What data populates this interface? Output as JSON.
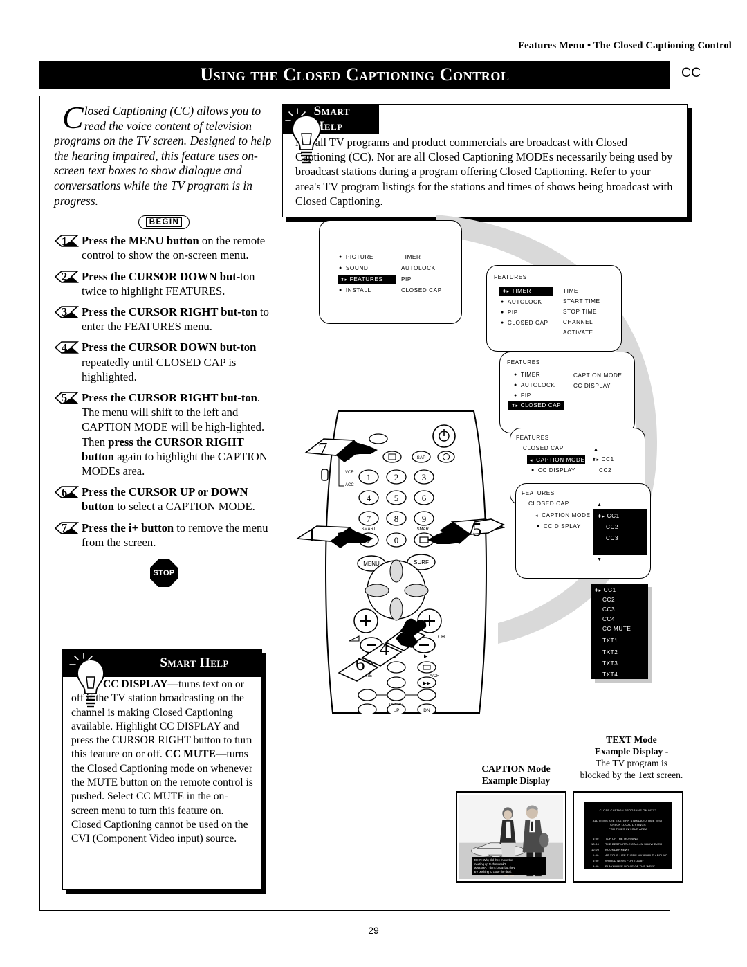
{
  "header": {
    "running_head": "Features Menu • The Closed Captioning Control",
    "title": "Using the Closed Captioning Control",
    "cc_badge": "CC"
  },
  "page_number": "29",
  "intro": {
    "dropcap": "C",
    "text": "losed Captioning (CC) allows you to read the voice content of television programs on the TV screen. Designed to help the hearing impaired, this feature uses on-screen text boxes to show dialogue and conversations while the TV program is in progress."
  },
  "begin_badge": "BEGIN",
  "steps": [
    {
      "num": "1",
      "bold": "Press the MENU button",
      "rest": " on the remote control to show the on-screen menu."
    },
    {
      "num": "2",
      "bold": "Press the CURSOR DOWN but-",
      "rest": ""
    },
    {
      "num": "3",
      "bold": "Press the CURSOR RIGHT but-",
      "rest": ""
    },
    {
      "num": "4",
      "bold": "Press the CURSOR DOWN but-",
      "rest": ""
    },
    {
      "num": "5",
      "bold": "Press the CURSOR RIGHT but-",
      "rest": ""
    },
    {
      "num": "6",
      "bold": "Press the CURSOR UP or",
      "rest": ""
    },
    {
      "num": "7",
      "bold": "Press the i+ button",
      "rest": " to remove the menu from the screen."
    }
  ],
  "step_lines": {
    "s2_b": "Press the CURSOR DOWN but-",
    "s2_t": "ton twice to highlight FEATURES.",
    "s3_b": "Press the CURSOR RIGHT but-",
    "s3_b2": "ton",
    "s3_t": " to enter the FEATURES menu.",
    "s4_b": "Press the CURSOR DOWN but-",
    "s4_b2": "ton",
    "s4_t": " repeatedly until CLOSED CAP is highlighted.",
    "s5_b": "Press the CURSOR RIGHT but-",
    "s5_b2": "ton",
    "s5_t": ". The menu will shift to the left and CAPTION MODE will be high-lighted. Then ",
    "s5_b3": "press the CURSOR RIGHT button",
    "s5_t2": " again to highlight the CAPTION MODEs area.",
    "s6_b": "Press the CURSOR UP or DOWN button",
    "s6_t": " to select a CAPTION MODE."
  },
  "stop_label": "STOP",
  "smart_help_top": {
    "label": "Smart Help",
    "text": "Not all TV programs and product commercials are broadcast with Closed Captioning (CC). Nor are all Closed Captioning MODEs necessarily being used by broadcast stations during a program offering Closed Captioning. Refer to your area's TV program listings for the stations and times of shows being broadcast with Closed Captioning."
  },
  "smart_help_bottom": {
    "label": "Smart Help",
    "p1_bold": "CC DISPLAY",
    "p1": "—turns text on or off if the TV station broadcasting on the channel is making Closed Captioning available. Highlight CC DISPLAY and press the CURSOR RIGHT button to turn this feature on or off.",
    "p2_bold": "CC MUTE",
    "p2": "—turns the Closed Captioning mode on whenever the MUTE button on the remote control is pushed. Select CC MUTE in the on-screen menu to turn this feature on. Closed Captioning cannot be used on the CVI (Component Video input) source."
  },
  "osd_screens": {
    "main_menu": {
      "left_items": [
        "PICTURE",
        "SOUND",
        "FEATURES",
        "INSTALL"
      ],
      "right_items": [
        "TIMER",
        "AUTOLOCK",
        "PIP",
        "CLOSED CAP"
      ],
      "highlighted": "FEATURES"
    },
    "features_timer": {
      "title": "FEATURES",
      "left_items": [
        "TIMER",
        "AUTOLOCK",
        "PIP",
        "CLOSED CAP"
      ],
      "right_items": [
        "TIME",
        "START TIME",
        "STOP TIME",
        "CHANNEL",
        "ACTIVATE"
      ],
      "highlighted": "TIMER"
    },
    "features_closedcap": {
      "title": "FEATURES",
      "left_items": [
        "TIMER",
        "AUTOLOCK",
        "PIP",
        "CLOSED CAP"
      ],
      "right_items": [
        "CAPTION MODE",
        "CC DISPLAY"
      ],
      "highlighted": "CLOSED CAP"
    },
    "closedcap_caption": {
      "title": "FEATURES",
      "subtitle": "CLOSED CAP",
      "left_items": [
        "CAPTION MODE",
        "CC DISPLAY"
      ],
      "right_items": [
        "CC1",
        "CC2"
      ],
      "highlighted": "CAPTION MODE"
    },
    "caption_modes": {
      "title": "FEATURES",
      "subtitle": "CLOSED CAP",
      "left_items": [
        "CAPTION MODE",
        "CC DISPLAY"
      ],
      "modes": [
        "CC1",
        "CC2",
        "CC3"
      ],
      "selected": "CC1"
    },
    "mode_list": {
      "items": [
        "CC1",
        "CC2",
        "CC3",
        "CC4",
        "CC MUTE",
        "TXT1",
        "TXT2",
        "TXT3",
        "TXT4"
      ],
      "selected": "CC1"
    }
  },
  "examples": {
    "caption_label_l1": "CAPTION Mode",
    "caption_label_l2": "Example Display",
    "text_label_l1": "TEXT Mode",
    "text_label_l2": "Example Display -",
    "text_label_l3": "The TV program is",
    "text_label_l4": "blocked by the Text screen.",
    "caption_overlay_l1": "JOHN: Why did they move  the",
    "caption_overlay_l2": "meeting up to this week?",
    "caption_overlay_l3": "MARSHA: I don't know, but they",
    "caption_overlay_l4": "are pushing to close the deal.",
    "text_screen": {
      "heading": "CLOSE CAPTION PROGRAMS ON WXYZ",
      "note1": "ALL ITEMS ARE EASTERN STANDARD TIME (EST)",
      "note2": "CHECK LOCAL LISTINGS",
      "note3": "FOR TIMES IN YOUR AREA",
      "listings": [
        {
          "time": "6:00",
          "name": "TOP OF THE MORNING"
        },
        {
          "time": "10:00",
          "name": "THE BEST LITTLE CALL-IN SHOW EVER"
        },
        {
          "time": "12:00",
          "name": "NOONDAY NEWS"
        },
        {
          "time": "1:00",
          "name": "AS YOUR LIFE TURNS MY WORLD AROUND"
        },
        {
          "time": "6:00",
          "name": "WORLD NEWS FOR TODAY"
        },
        {
          "time": "9:00",
          "name": "PLAYHOUSE MOVIE OF THE WEEK"
        }
      ]
    }
  },
  "remote": {
    "keys": [
      "1",
      "2",
      "3",
      "4",
      "5",
      "6",
      "7",
      "8",
      "9",
      "0"
    ],
    "menu": "MENU",
    "surf": "SURF",
    "sap": "SAP",
    "smart_left": "SMART",
    "smart_right": "SMART",
    "vcr": "VCR",
    "acc": "ACC",
    "tv": "TV",
    "ch": "CH",
    "ach": "A/CH",
    "pip_ch": "PIP CH",
    "up": "UP",
    "dn": "DN",
    "mute": "MUTE"
  },
  "callouts": [
    "1",
    "2",
    "3",
    "4",
    "5",
    "6",
    "7"
  ]
}
